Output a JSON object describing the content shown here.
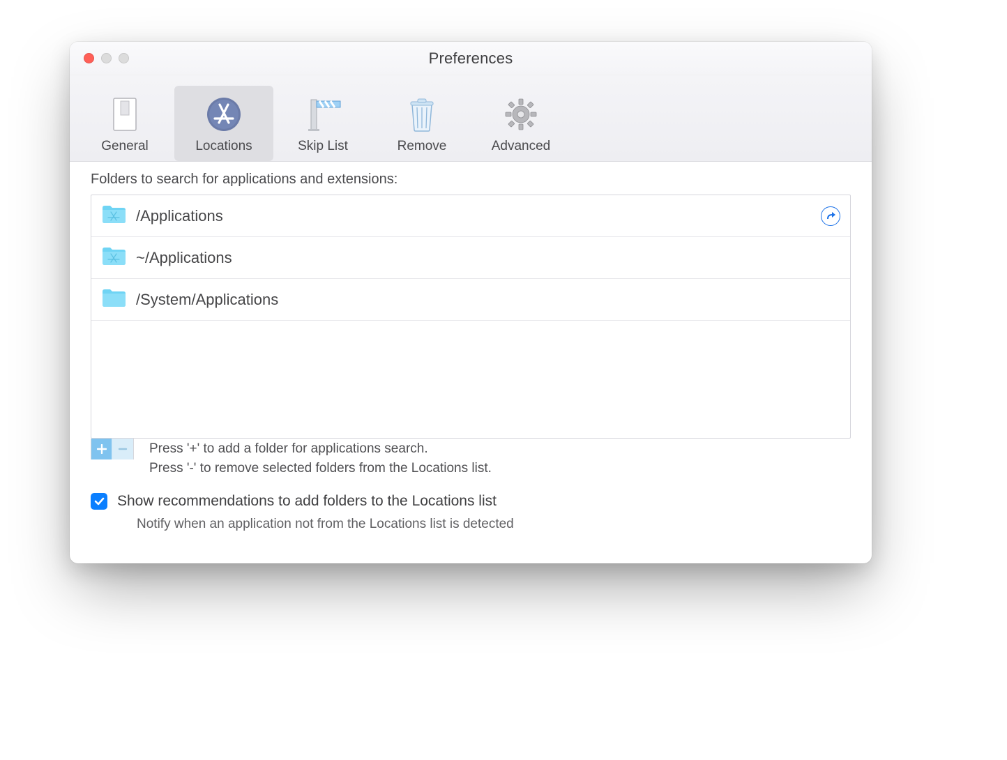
{
  "window": {
    "title": "Preferences"
  },
  "toolbar": {
    "items": [
      {
        "id": "general",
        "label": "General"
      },
      {
        "id": "locations",
        "label": "Locations"
      },
      {
        "id": "skiplist",
        "label": "Skip List"
      },
      {
        "id": "remove",
        "label": "Remove"
      },
      {
        "id": "advanced",
        "label": "Advanced"
      }
    ],
    "active": "locations"
  },
  "locations": {
    "section_label": "Folders to search for applications and extensions:",
    "folders": [
      {
        "path": "/Applications",
        "icon": "app-folder",
        "reveal": true
      },
      {
        "path": "~/Applications",
        "icon": "app-folder",
        "reveal": false
      },
      {
        "path": "/System/Applications",
        "icon": "plain-folder",
        "reveal": false
      }
    ],
    "hints": {
      "add": "Press '+' to add a folder for applications search.",
      "remove": "Press '-'  to remove selected folders from the Locations list."
    },
    "recommend": {
      "checked": true,
      "label": "Show recommendations to add folders to the Locations list",
      "description": "Notify when an application not from the Locations list is detected"
    }
  }
}
